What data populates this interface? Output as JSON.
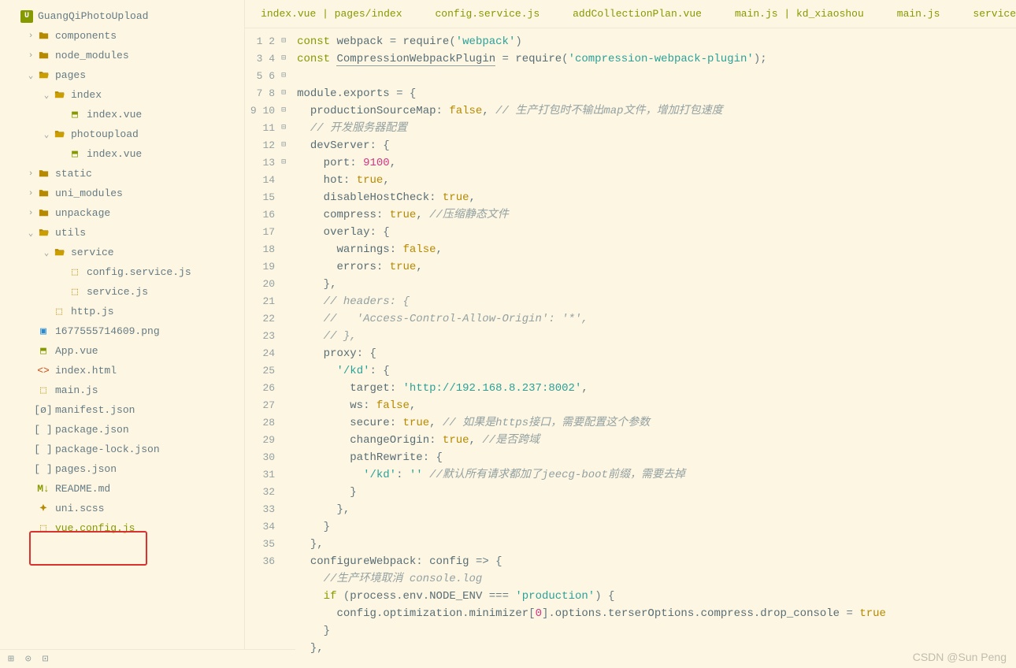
{
  "project_name": "GuangQiPhotoUpload",
  "watermark": "CSDN @Sun Peng",
  "tree": [
    {
      "depth": 0,
      "chev": "",
      "icon": "project",
      "label": "GuangQiPhotoUpload"
    },
    {
      "depth": 1,
      "chev": ">",
      "icon": "folder",
      "label": "components"
    },
    {
      "depth": 1,
      "chev": ">",
      "icon": "folder",
      "label": "node_modules"
    },
    {
      "depth": 1,
      "chev": "v",
      "icon": "folder-open",
      "label": "pages"
    },
    {
      "depth": 2,
      "chev": "v",
      "icon": "folder-open",
      "label": "index"
    },
    {
      "depth": 3,
      "chev": "",
      "icon": "vue",
      "label": "index.vue"
    },
    {
      "depth": 2,
      "chev": "v",
      "icon": "folder-open",
      "label": "photoupload"
    },
    {
      "depth": 3,
      "chev": "",
      "icon": "vue",
      "label": "index.vue"
    },
    {
      "depth": 1,
      "chev": ">",
      "icon": "folder",
      "label": "static"
    },
    {
      "depth": 1,
      "chev": ">",
      "icon": "folder",
      "label": "uni_modules"
    },
    {
      "depth": 1,
      "chev": ">",
      "icon": "folder",
      "label": "unpackage"
    },
    {
      "depth": 1,
      "chev": "v",
      "icon": "folder-open",
      "label": "utils"
    },
    {
      "depth": 2,
      "chev": "v",
      "icon": "folder-open",
      "label": "service"
    },
    {
      "depth": 3,
      "chev": "",
      "icon": "js",
      "label": "config.service.js"
    },
    {
      "depth": 3,
      "chev": "",
      "icon": "js",
      "label": "service.js"
    },
    {
      "depth": 2,
      "chev": "",
      "icon": "js",
      "label": "http.js"
    },
    {
      "depth": 1,
      "chev": "",
      "icon": "png",
      "label": "1677555714609.png"
    },
    {
      "depth": 1,
      "chev": "",
      "icon": "vue",
      "label": "App.vue"
    },
    {
      "depth": 1,
      "chev": "",
      "icon": "html",
      "label": "index.html"
    },
    {
      "depth": 1,
      "chev": "",
      "icon": "js",
      "label": "main.js"
    },
    {
      "depth": 1,
      "chev": "",
      "icon": "json-m",
      "label": "manifest.json"
    },
    {
      "depth": 1,
      "chev": "",
      "icon": "json",
      "label": "package.json"
    },
    {
      "depth": 1,
      "chev": "",
      "icon": "json",
      "label": "package-lock.json"
    },
    {
      "depth": 1,
      "chev": "",
      "icon": "json",
      "label": "pages.json"
    },
    {
      "depth": 1,
      "chev": "",
      "icon": "md",
      "label": "README.md"
    },
    {
      "depth": 1,
      "chev": "",
      "icon": "scss",
      "label": "uni.scss"
    },
    {
      "depth": 1,
      "chev": "",
      "icon": "js",
      "label": "vue.config.js",
      "selected": true
    }
  ],
  "tabs": [
    "index.vue | pages/index",
    "config.service.js",
    "addCollectionPlan.vue",
    "main.js | kd_xiaoshou",
    "main.js",
    "service"
  ],
  "gutter_start": 1,
  "gutter_end": 36,
  "fold_markers": {
    "4": "⊟",
    "7": "⊟",
    "12": "⊟",
    "19": "⊟",
    "20": "⊟",
    "25": "⊟",
    "31": "⊟",
    "33": "⊟"
  },
  "code_lines": [
    [
      [
        "kw",
        "const"
      ],
      [
        "sp",
        " "
      ],
      [
        "def",
        "webpack"
      ],
      [
        "sp",
        " "
      ],
      [
        "op",
        "= "
      ],
      [
        "fn",
        "require"
      ],
      [
        "op",
        "("
      ],
      [
        "str",
        "'webpack'"
      ],
      [
        "op",
        ")"
      ]
    ],
    [
      [
        "kw",
        "const"
      ],
      [
        "sp",
        " "
      ],
      [
        "var",
        "CompressionWebpackPlugin"
      ],
      [
        "sp",
        " "
      ],
      [
        "op",
        "= "
      ],
      [
        "fn",
        "require"
      ],
      [
        "op",
        "("
      ],
      [
        "str",
        "'compression-webpack-plugin'"
      ],
      [
        "op",
        ");"
      ]
    ],
    [],
    [
      [
        "def",
        "module"
      ],
      [
        "op",
        "."
      ],
      [
        "prop",
        "exports"
      ],
      [
        "sp",
        " "
      ],
      [
        "op",
        "= {"
      ]
    ],
    [
      [
        "sp",
        "  "
      ],
      [
        "prop",
        "productionSourceMap"
      ],
      [
        "op",
        ": "
      ],
      [
        "bool",
        "false"
      ],
      [
        "op",
        ", "
      ],
      [
        "comment",
        "// 生产打包时不输出map文件，增加打包速度"
      ]
    ],
    [
      [
        "sp",
        "  "
      ],
      [
        "comment",
        "// 开发服务器配置"
      ]
    ],
    [
      [
        "sp",
        "  "
      ],
      [
        "prop",
        "devServer"
      ],
      [
        "op",
        ": {"
      ]
    ],
    [
      [
        "sp",
        "    "
      ],
      [
        "prop",
        "port"
      ],
      [
        "op",
        ": "
      ],
      [
        "num",
        "9100"
      ],
      [
        "op",
        ","
      ]
    ],
    [
      [
        "sp",
        "    "
      ],
      [
        "prop",
        "hot"
      ],
      [
        "op",
        ": "
      ],
      [
        "bool",
        "true"
      ],
      [
        "op",
        ","
      ]
    ],
    [
      [
        "sp",
        "    "
      ],
      [
        "prop",
        "disableHostCheck"
      ],
      [
        "op",
        ": "
      ],
      [
        "bool",
        "true"
      ],
      [
        "op",
        ","
      ]
    ],
    [
      [
        "sp",
        "    "
      ],
      [
        "prop",
        "compress"
      ],
      [
        "op",
        ": "
      ],
      [
        "bool",
        "true"
      ],
      [
        "op",
        ", "
      ],
      [
        "comment",
        "//压缩静态文件"
      ]
    ],
    [
      [
        "sp",
        "    "
      ],
      [
        "prop",
        "overlay"
      ],
      [
        "op",
        ": {"
      ]
    ],
    [
      [
        "sp",
        "      "
      ],
      [
        "prop",
        "warnings"
      ],
      [
        "op",
        ": "
      ],
      [
        "bool",
        "false"
      ],
      [
        "op",
        ","
      ]
    ],
    [
      [
        "sp",
        "      "
      ],
      [
        "prop",
        "errors"
      ],
      [
        "op",
        ": "
      ],
      [
        "bool",
        "true"
      ],
      [
        "op",
        ","
      ]
    ],
    [
      [
        "sp",
        "    "
      ],
      [
        "op",
        "},"
      ]
    ],
    [
      [
        "sp",
        "    "
      ],
      [
        "comment",
        "// headers: {"
      ]
    ],
    [
      [
        "sp",
        "    "
      ],
      [
        "comment",
        "//   'Access-Control-Allow-Origin': '*',"
      ]
    ],
    [
      [
        "sp",
        "    "
      ],
      [
        "comment",
        "// },"
      ]
    ],
    [
      [
        "sp",
        "    "
      ],
      [
        "prop",
        "proxy"
      ],
      [
        "op",
        ": {"
      ]
    ],
    [
      [
        "sp",
        "      "
      ],
      [
        "str",
        "'/kd'"
      ],
      [
        "op",
        ": {"
      ]
    ],
    [
      [
        "sp",
        "        "
      ],
      [
        "prop",
        "target"
      ],
      [
        "op",
        ": "
      ],
      [
        "str",
        "'http://192.168.8.237:8002'"
      ],
      [
        "op",
        ","
      ]
    ],
    [
      [
        "sp",
        "        "
      ],
      [
        "prop",
        "ws"
      ],
      [
        "op",
        ": "
      ],
      [
        "bool",
        "false"
      ],
      [
        "op",
        ","
      ]
    ],
    [
      [
        "sp",
        "        "
      ],
      [
        "prop",
        "secure"
      ],
      [
        "op",
        ": "
      ],
      [
        "bool",
        "true"
      ],
      [
        "op",
        ", "
      ],
      [
        "comment",
        "// 如果是https接口，需要配置这个参数"
      ]
    ],
    [
      [
        "sp",
        "        "
      ],
      [
        "prop",
        "changeOrigin"
      ],
      [
        "op",
        ": "
      ],
      [
        "bool",
        "true"
      ],
      [
        "op",
        ", "
      ],
      [
        "comment",
        "//是否跨域"
      ]
    ],
    [
      [
        "sp",
        "        "
      ],
      [
        "prop",
        "pathRewrite"
      ],
      [
        "op",
        ": {"
      ]
    ],
    [
      [
        "sp",
        "          "
      ],
      [
        "str",
        "'/kd'"
      ],
      [
        "op",
        ": "
      ],
      [
        "str",
        "''"
      ],
      [
        "sp",
        " "
      ],
      [
        "comment",
        "//默认所有请求都加了jeecg-boot前缀，需要去掉"
      ]
    ],
    [
      [
        "sp",
        "        "
      ],
      [
        "op",
        "}"
      ]
    ],
    [
      [
        "sp",
        "      "
      ],
      [
        "op",
        "},"
      ]
    ],
    [
      [
        "sp",
        "    "
      ],
      [
        "op",
        "}"
      ]
    ],
    [
      [
        "sp",
        "  "
      ],
      [
        "op",
        "},"
      ]
    ],
    [
      [
        "sp",
        "  "
      ],
      [
        "prop",
        "configureWebpack"
      ],
      [
        "op",
        ": "
      ],
      [
        "def",
        "config"
      ],
      [
        "sp",
        " "
      ],
      [
        "op",
        "=> {"
      ]
    ],
    [
      [
        "sp",
        "    "
      ],
      [
        "comment",
        "//生产环境取消 console.log"
      ]
    ],
    [
      [
        "sp",
        "    "
      ],
      [
        "kw",
        "if"
      ],
      [
        "sp",
        " "
      ],
      [
        "op",
        "("
      ],
      [
        "def",
        "process"
      ],
      [
        "op",
        "."
      ],
      [
        "prop",
        "env"
      ],
      [
        "op",
        "."
      ],
      [
        "prop",
        "NODE_ENV"
      ],
      [
        "sp",
        " "
      ],
      [
        "op",
        "=== "
      ],
      [
        "str",
        "'production'"
      ],
      [
        "op",
        ") {"
      ]
    ],
    [
      [
        "sp",
        "      "
      ],
      [
        "def",
        "config"
      ],
      [
        "op",
        "."
      ],
      [
        "prop",
        "optimization"
      ],
      [
        "op",
        "."
      ],
      [
        "prop",
        "minimizer"
      ],
      [
        "op",
        "["
      ],
      [
        "num",
        "0"
      ],
      [
        "op",
        "]."
      ],
      [
        "prop",
        "options"
      ],
      [
        "op",
        "."
      ],
      [
        "prop",
        "terserOptions"
      ],
      [
        "op",
        "."
      ],
      [
        "prop",
        "compress"
      ],
      [
        "op",
        "."
      ],
      [
        "prop",
        "drop_console"
      ],
      [
        "sp",
        " "
      ],
      [
        "op",
        "= "
      ],
      [
        "bool",
        "true"
      ]
    ],
    [
      [
        "sp",
        "    "
      ],
      [
        "op",
        "}"
      ]
    ],
    [
      [
        "sp",
        "  "
      ],
      [
        "op",
        "},"
      ]
    ]
  ]
}
